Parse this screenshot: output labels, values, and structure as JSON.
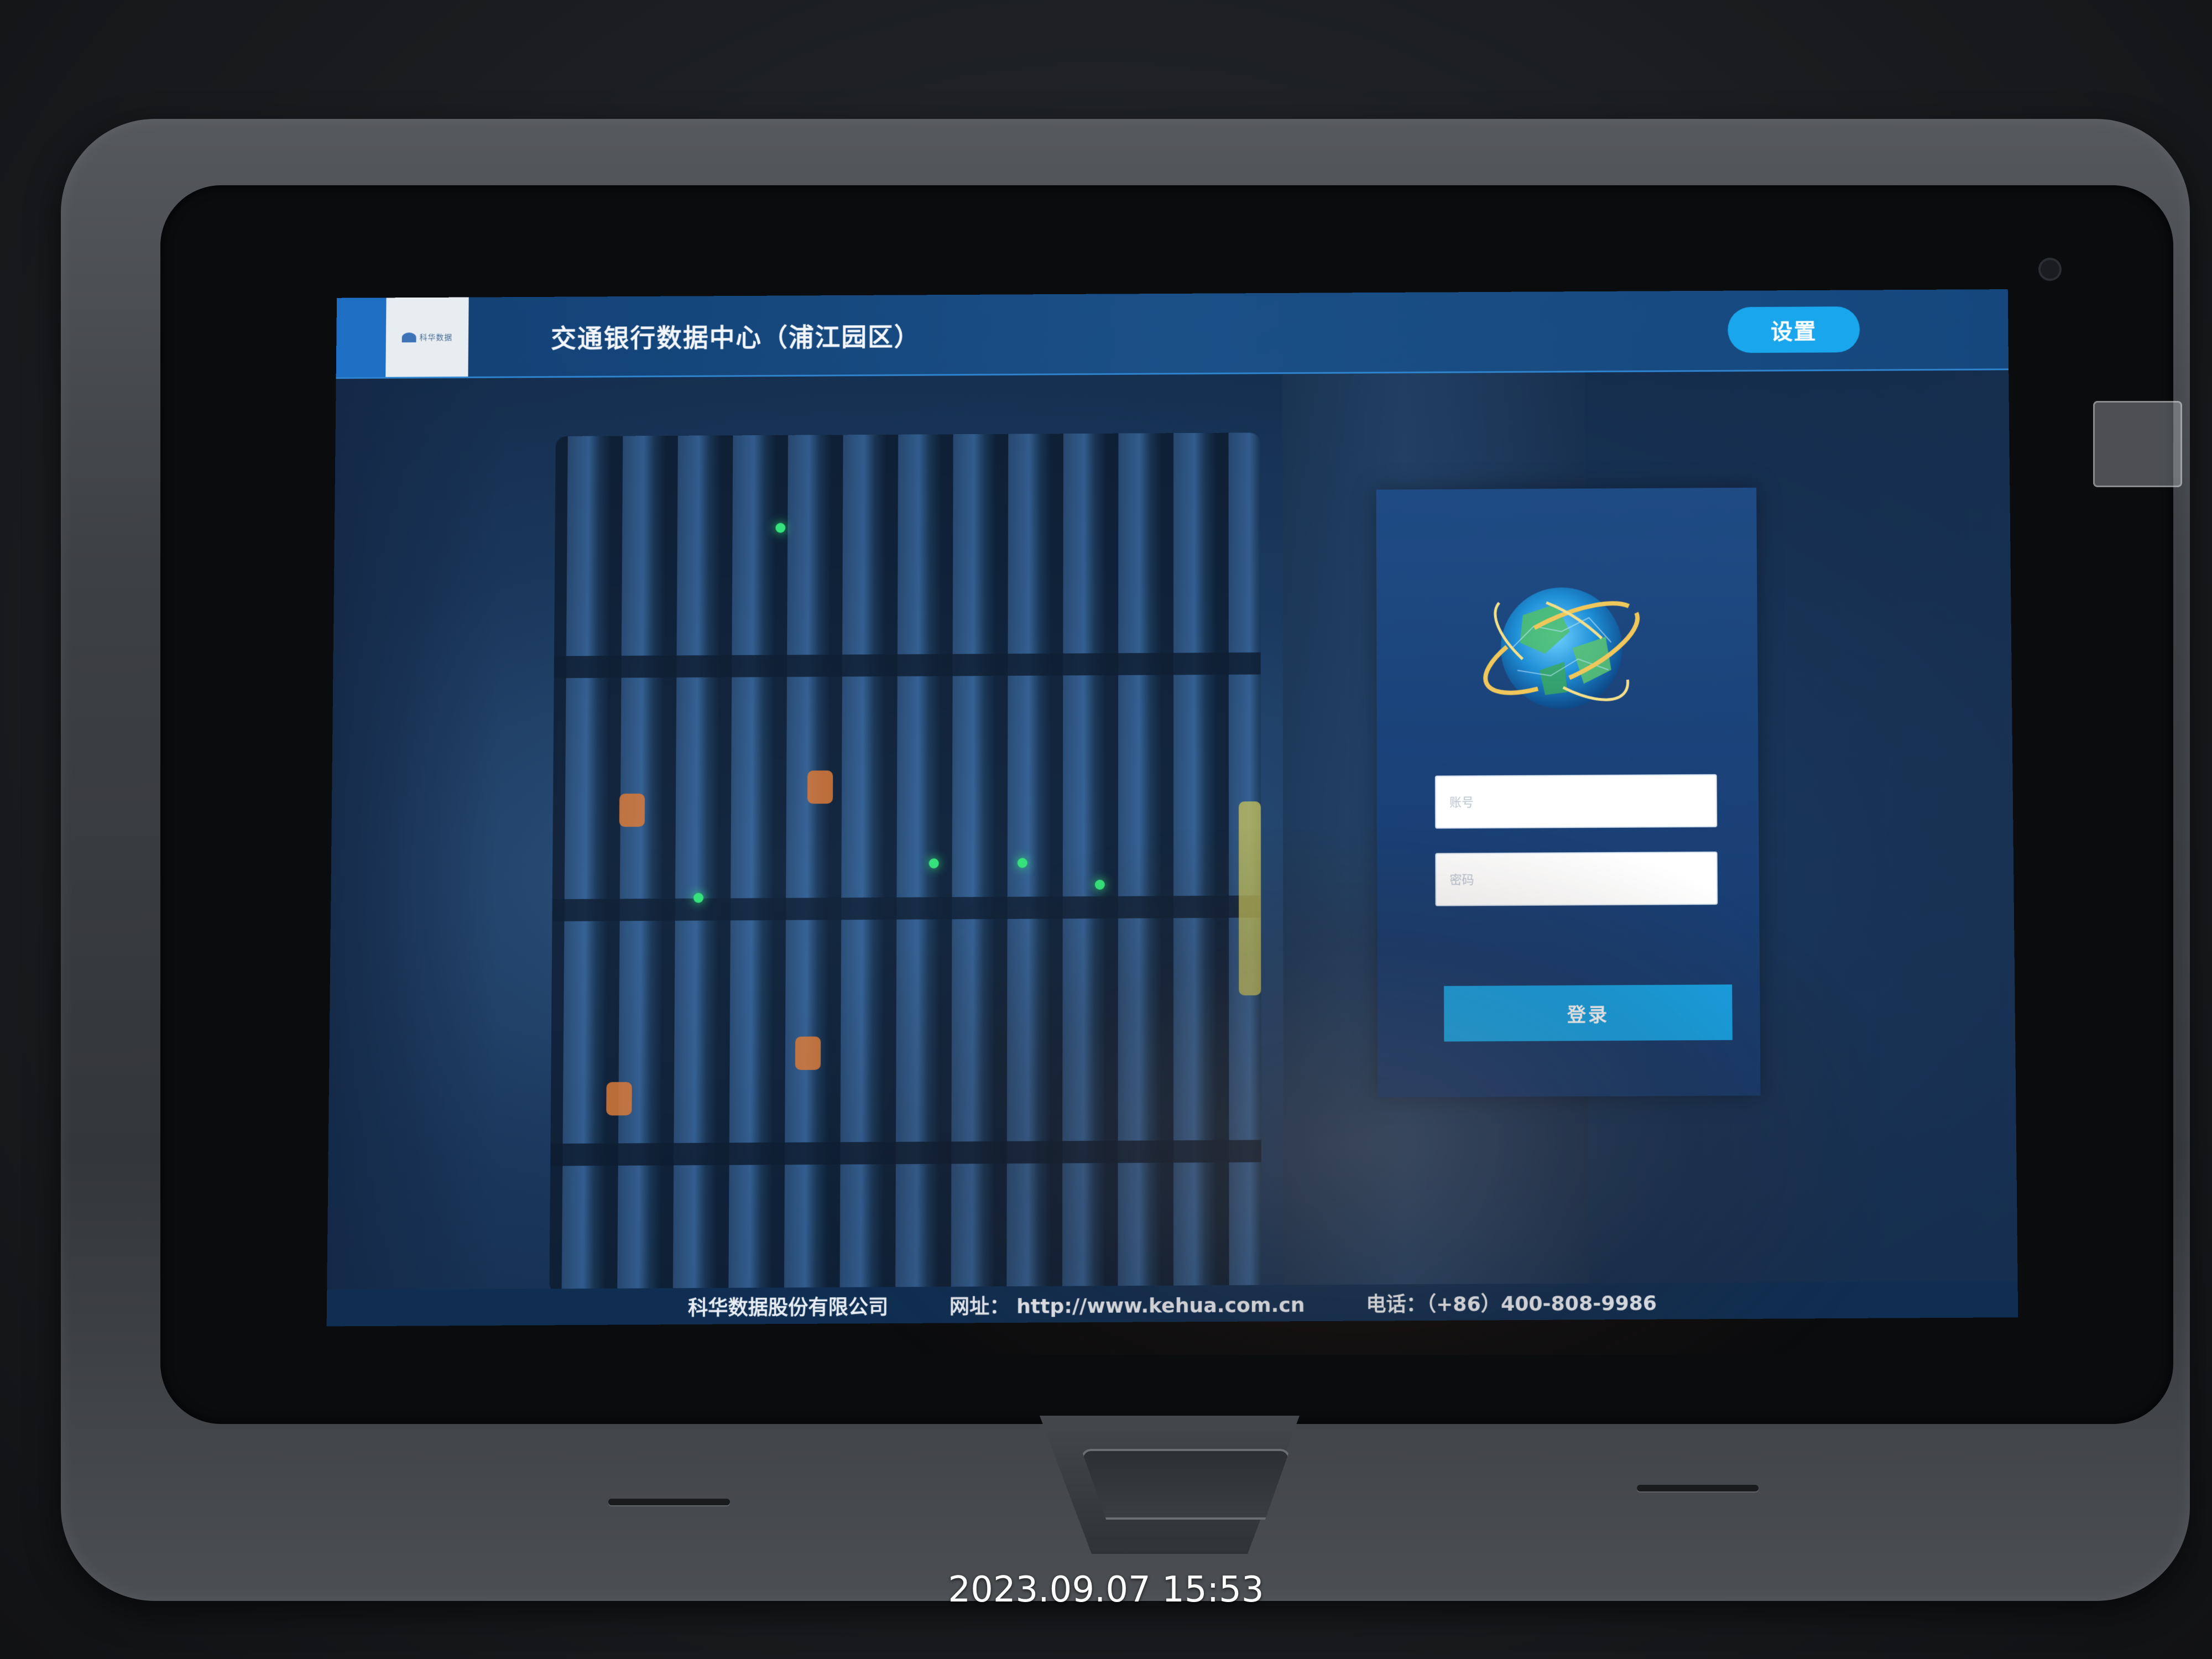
{
  "header": {
    "logo_text": "科华数据",
    "title": "交通银行数据中心（浦江园区）",
    "settings_label": "设置"
  },
  "login": {
    "username_placeholder": "账号",
    "password_placeholder": "密码",
    "login_label": "登录"
  },
  "footer": {
    "company": "科华数据股份有限公司",
    "website": "网址： http://www.kehua.com.cn",
    "phone": "电话：（+86）400-808-9986"
  },
  "photo": {
    "timestamp": "2023.09.07 15:53"
  },
  "colors": {
    "accent": "#19a6ec",
    "header_bg": "#1a4f86",
    "panel_bg": "#1f4b84"
  }
}
